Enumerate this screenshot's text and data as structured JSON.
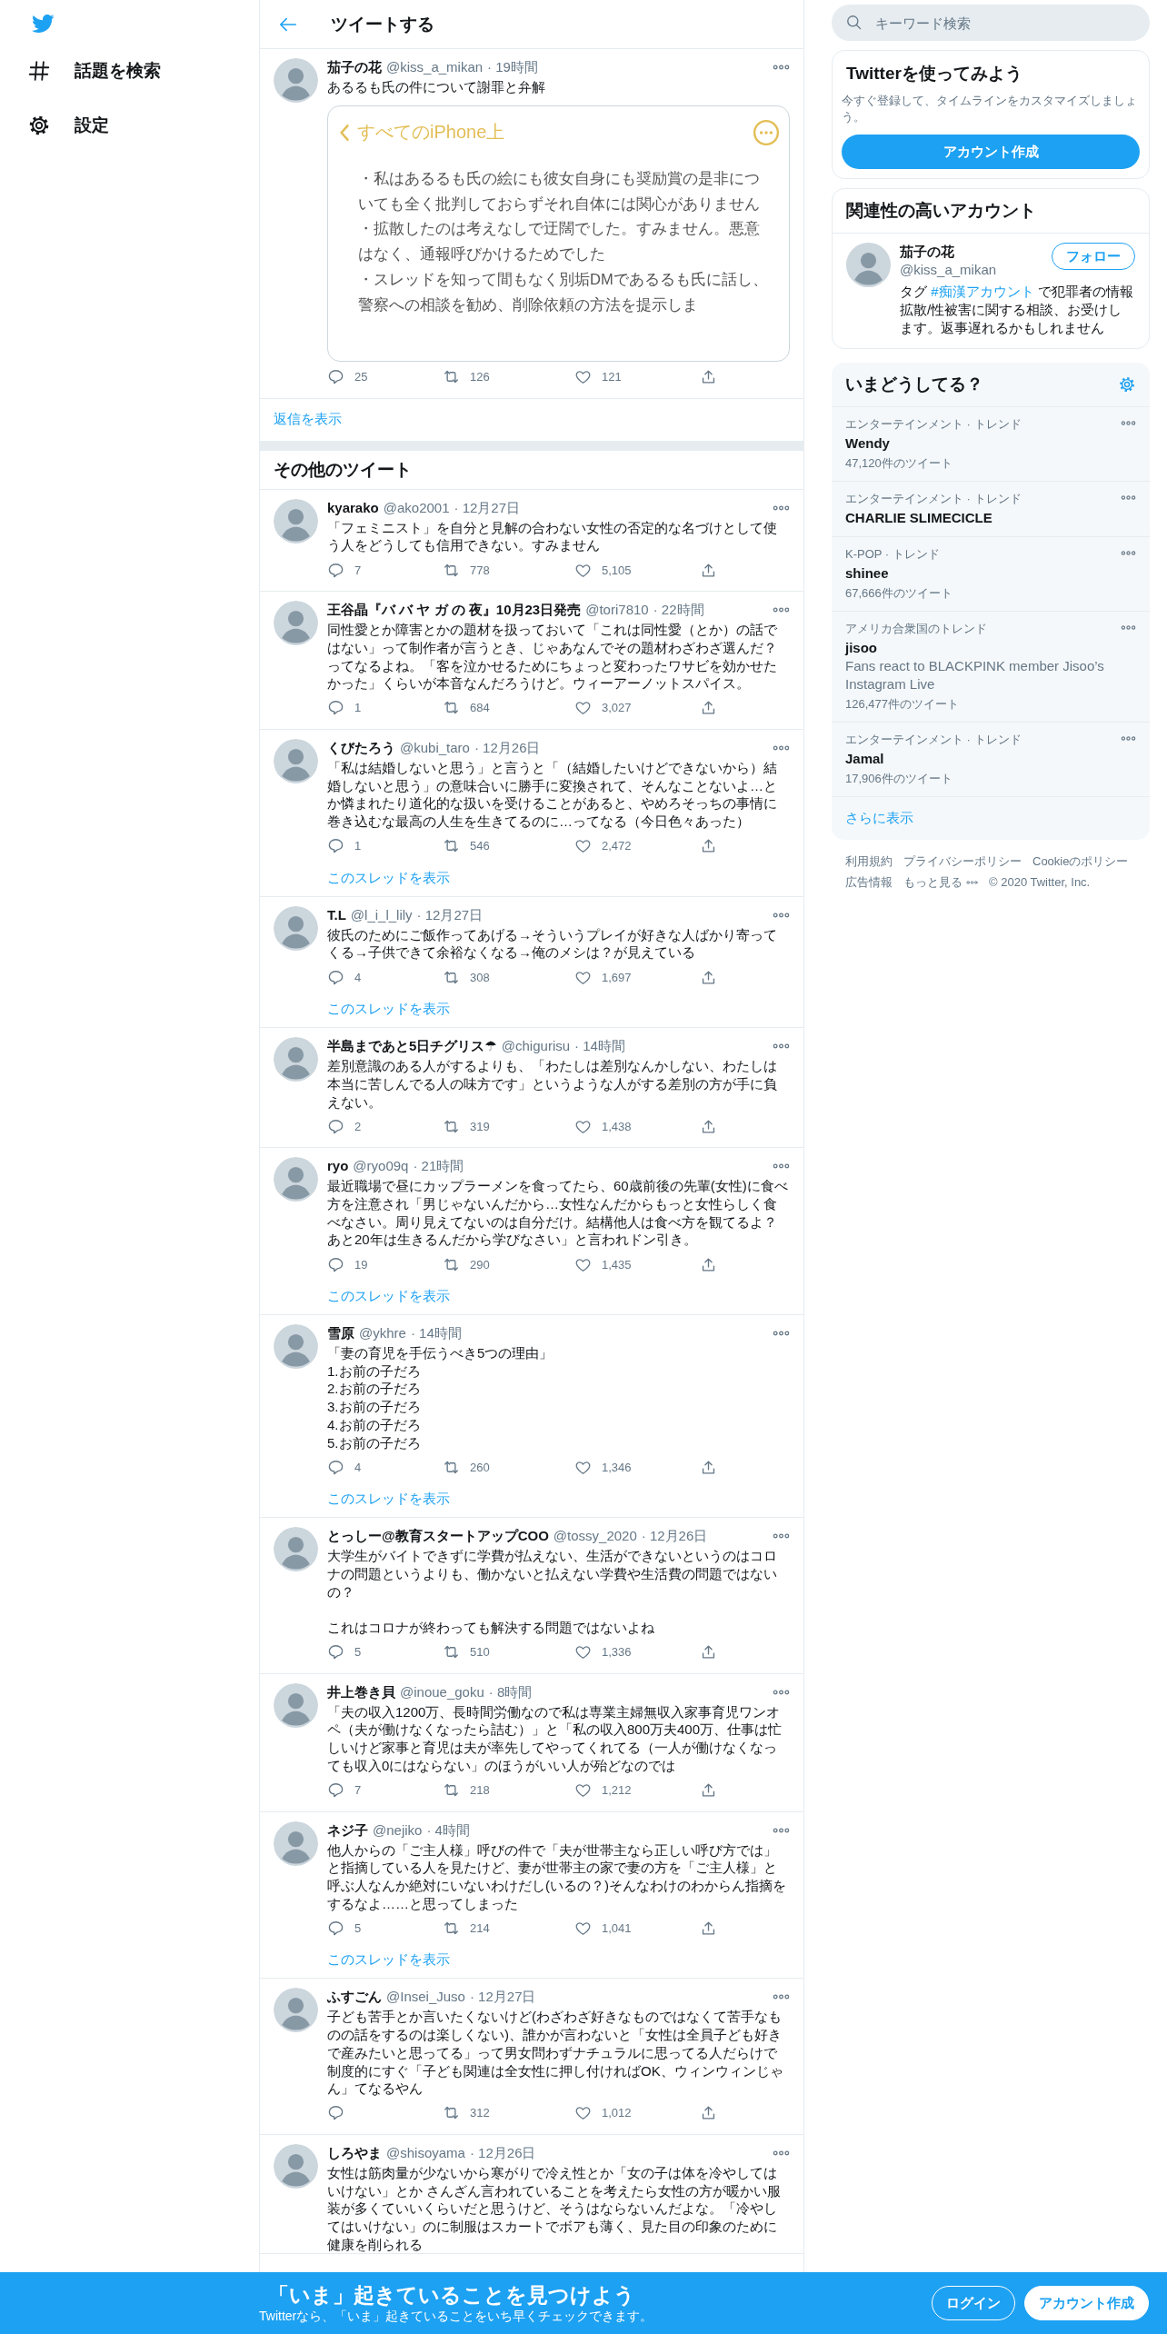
{
  "nav": {
    "items": [
      {
        "kind": "explore",
        "label": "話題を検索"
      },
      {
        "kind": "settings",
        "label": "設定"
      }
    ]
  },
  "header": {
    "title": "ツイートする"
  },
  "main_tweet": {
    "name": "茄子の花",
    "handle": "@kiss_a_mikan",
    "time": "· 19時間",
    "text": "あるるも氏の件について謝罪と弁解",
    "image": {
      "kind": "notes_screenshot",
      "back_label": "すべてのiPhone上",
      "paragraphs": [
        "・私はあるるも氏の絵にも彼女自身にも奨励賞の是非についても全く批判しておらずそれ自体には関心がありません",
        "・拡散したのは考えなしで迂闊でした。すみません。悪意はなく、通報呼びかけるためでした",
        "・スレッドを知って間もなく別垢DMであるるも氏に話し、警察への相談を勧め、削除依頼の方法を提示しま"
      ]
    },
    "replies": "25",
    "retweets": "126",
    "likes": "121"
  },
  "show_replies": "返信を表示",
  "more_tweets": {
    "title": "その他のツイート",
    "tweets": [
      {
        "name": "kyarako",
        "handle": "@ako2001",
        "time": "· 12月27日",
        "text": "「フェミニスト」を自分と見解の合わない女性の否定的な名づけとして使う人をどうしても信用できない。すみません",
        "replies": "7",
        "retweets": "778",
        "likes": "5,105"
      },
      {
        "name": "王谷晶『バ バ ヤ ガ の 夜』10月23日発売",
        "handle": "@tori7810",
        "time": "· 22時間",
        "text": "同性愛とか障害とかの題材を扱っておいて「これは同性愛（とか）の話ではない」って制作者が言うとき、じゃあなんでその題材わざわざ選んだ？ってなるよね。「客を泣かせるためにちょっと変わったワサビを効かせたかった」くらいが本音なんだろうけど。ウィーアーノットスパイス。",
        "replies": "1",
        "retweets": "684",
        "likes": "3,027"
      },
      {
        "name": "くびたろう",
        "handle": "@kubi_taro",
        "time": "· 12月26日",
        "text": "「私は結婚しないと思う」と言うと「（結婚したいけどできないから）結婚しないと思う」の意味合いに勝手に変換されて、そんなことないよ…とか憐まれたり道化的な扱いを受けることがあると、やめろそっちの事情に巻き込むな最高の人生を生きてるのに…ってなる（今日色々あった）",
        "replies": "1",
        "retweets": "546",
        "likes": "2,472",
        "thread_link": "このスレッドを表示"
      },
      {
        "name": "T.L",
        "handle": "@l_i_l_lily",
        "time": "· 12月27日",
        "text": "彼氏のためにご飯作ってあげる→そういうプレイが好きな人ばかり寄ってくる→子供できて余裕なくなる→俺のメシは？が見えている",
        "replies": "4",
        "retweets": "308",
        "likes": "1,697",
        "thread_link": "このスレッドを表示"
      },
      {
        "name": "半島まであと5日チグリス☂",
        "handle": "@chigurisu",
        "time": "· 14時間",
        "text": "差別意識のある人がするよりも、「わたしは差別なんかしない、わたしは本当に苦しんでる人の味方です」というような人がする差別の方が手に負えない。",
        "replies": "2",
        "retweets": "319",
        "likes": "1,438"
      },
      {
        "name": "ryo",
        "handle": "@ryo09q",
        "time": "· 21時間",
        "text": "最近職場で昼にカップラーメンを食ってたら、60歳前後の先輩(女性)に食べ方を注意され「男じゃないんだから…女性なんだからもっと女性らしく食べなさい。周り見えてないのは自分だけ。結構他人は食べ方を観てるよ？あと20年は生きるんだから学びなさい」と言われドン引き。",
        "replies": "19",
        "retweets": "290",
        "likes": "1,435",
        "thread_link": "このスレッドを表示"
      },
      {
        "name": "雪原",
        "handle": "@ykhre",
        "time": "· 14時間",
        "text": "「妻の育児を手伝うべき5つの理由」\n1.お前の子だろ\n2.お前の子だろ\n3.お前の子だろ\n4.お前の子だろ\n5.お前の子だろ",
        "replies": "4",
        "retweets": "260",
        "likes": "1,346",
        "thread_link": "このスレッドを表示"
      },
      {
        "name": "とっしー@教育スタートアップCOO",
        "handle": "@tossy_2020",
        "time": "· 12月26日",
        "text": [
          "大学生がバイトできずに学費が払えない、生活ができないというのはコロナの問題というよりも、働かないと払えない学費や生活費の問題ではないの？",
          "これはコロナが終わっても解決する問題ではないよね"
        ],
        "replies": "5",
        "retweets": "510",
        "likes": "1,336"
      },
      {
        "name": "井上巻き貝",
        "handle": "@inoue_goku",
        "time": "· 8時間",
        "text": "「夫の収入1200万、長時間労働なので私は専業主婦無収入家事育児ワンオペ（夫が働けなくなったら詰む）」と「私の収入800万夫400万、仕事は忙しいけど家事と育児は夫が率先してやってくれてる（一人が働けなくなっても収入0にはならない」のほうがいい人が殆どなのでは",
        "replies": "7",
        "retweets": "218",
        "likes": "1,212"
      },
      {
        "name": "ネジ子",
        "handle": "@nejiko",
        "time": "· 4時間",
        "text": "他人からの「ご主人様」呼びの件で「夫が世帯主なら正しい呼び方では」と指摘している人を見たけど、妻が世帯主の家で妻の方を「ご主人様」と呼ぶ人なんか絶対にいないわけだし(いるの？)そんなわけのわからん指摘をするなよ……と思ってしまった",
        "replies": "5",
        "retweets": "214",
        "likes": "1,041",
        "thread_link": "このスレッドを表示"
      },
      {
        "name": "ふすごん",
        "handle": "@Insei_Juso",
        "time": "· 12月27日",
        "text": "子ども苦手とか言いたくないけど(わざわざ好きなものではなくて苦手なものの話をするのは楽しくない)、誰かが言わないと「女性は全員子ども好きで産みたいと思ってる」って男女問わずナチュラルに思ってる人だらけで制度的にすぐ「子ども関連は全女性に押し付ければOK、ウィンウィンじゃん」てなるやん",
        "retweets": "312",
        "likes": "1,012"
      },
      {
        "name": "しろやま",
        "handle": "@shisoyama",
        "time": "· 12月26日",
        "text": "女性は筋肉量が少ないから寒がりで冷え性とか「女の子は体を冷やしてはいけない」とか さんざん言われていることを考えたら女性の方が暖かい服装が多くていいくらいだと思うけど、そうはならないんだよな。「冷やしてはいけない」のに制服はスカートでボアも薄く、見た目の印象のために健康を削られる"
      }
    ]
  },
  "sidebar": {
    "search": {
      "placeholder": "キーワード検索"
    },
    "signup": {
      "title": "Twitterを使ってみよう",
      "text": "今すぐ登録して、タイムラインをカスタマイズしましょう。",
      "button": "アカウント作成"
    },
    "suggestions": {
      "title": "関連性の高いアカウント",
      "account": {
        "name": "茄子の花",
        "handle": "@kiss_a_mikan",
        "follow": "フォロー",
        "bio_before": "タグ ",
        "bio_link": "#痴漢アカウント",
        "bio_after": " で犯罪者の情報拡散/性被害に関する相談、お受けします。返事遅れるかもしれません"
      }
    },
    "trends": {
      "title": "いまどうしてる？",
      "items": [
        {
          "category": "エンターテインメント · トレンド",
          "name": "Wendy",
          "count": "47,120件のツイート"
        },
        {
          "category": "エンターテインメント · トレンド",
          "name": "CHARLIE SLIMECICLE"
        },
        {
          "category": "K-POP · トレンド",
          "name": "shinee",
          "count": "67,666件のツイート"
        },
        {
          "category": "アメリカ合衆国のトレンド",
          "name": "jisoo",
          "description": "Fans react to BLACKPINK member Jisoo’s Instagram Live",
          "count": "126,477件のツイート"
        },
        {
          "category": "エンターテインメント · トレンド",
          "name": "Jamal",
          "count": "17,906件のツイート"
        }
      ],
      "more": "さらに表示"
    },
    "footer": {
      "links": [
        "利用規約",
        "プライバシーポリシー",
        "Cookieのポリシー",
        "広告情報"
      ],
      "more": "もっと見る",
      "copyright": "© 2020 Twitter, Inc."
    }
  },
  "banner": {
    "title": "「いま」起きていることを見つけよう",
    "subtitle": "Twitterなら、「いま」起きていることをいち早くチェックできます。",
    "buttons": [
      {
        "kind": "outline",
        "label": "ログイン"
      },
      {
        "kind": "filled",
        "label": "アカウント作成"
      }
    ]
  }
}
